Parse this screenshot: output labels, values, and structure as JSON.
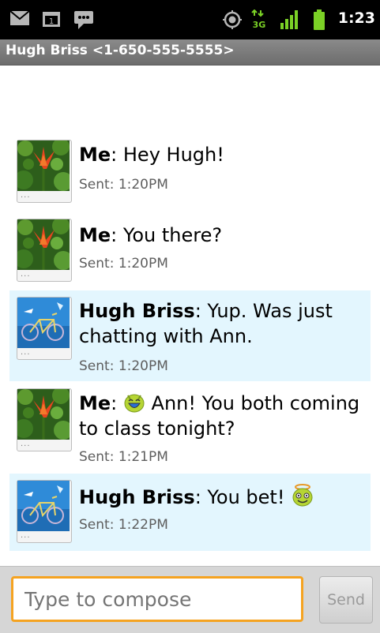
{
  "status_bar": {
    "time": "1:23",
    "icons": [
      "gmail-icon",
      "calendar-icon",
      "sms-icon",
      "gps-icon",
      "3g-data-icon",
      "signal-icon",
      "battery-icon"
    ],
    "network_label": "3G"
  },
  "conversation": {
    "title": "Hugh Briss <1-650-555-5555>"
  },
  "messages": [
    {
      "sender": "Me",
      "body": ": Hey Hugh!",
      "sent": "Sent: 1:20PM",
      "from_me": true
    },
    {
      "sender": "Me",
      "body": ": You there?",
      "sent": "Sent: 1:20PM",
      "from_me": true
    },
    {
      "sender": "Hugh Briss",
      "body": ": Yup. Was just chatting with Ann.",
      "sent": "Sent: 1:20PM",
      "from_me": false
    },
    {
      "sender": "Me",
      "body_before": ": ",
      "emoji": "laughing-emoji",
      "body_after": " Ann! You both coming to class tonight?",
      "sent": "Sent: 1:21PM",
      "from_me": true
    },
    {
      "sender": "Hugh Briss",
      "body": ": You bet! ",
      "emoji": "angel-emoji",
      "sent": "Sent: 1:22PM",
      "from_me": false
    }
  ],
  "avatar_more": "...",
  "compose": {
    "placeholder": "Type to compose",
    "send_label": "Send"
  },
  "colors": {
    "incoming_bubble": "#e3f6fe",
    "compose_focus": "#f5a321",
    "status_bar": "#000000",
    "title_bar": "#7a7a7a"
  }
}
